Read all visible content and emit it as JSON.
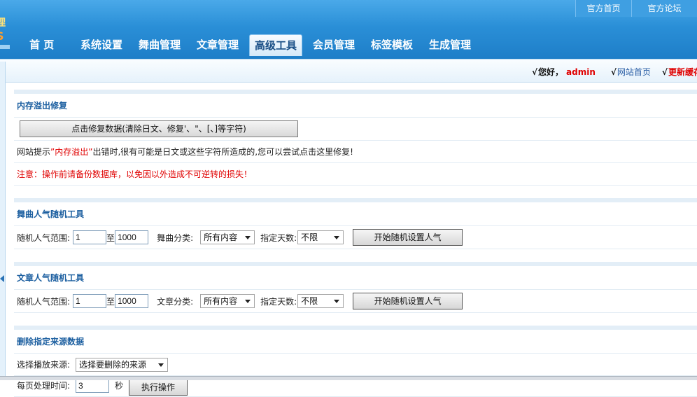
{
  "logo": {
    "char1": "理",
    "char2": "S"
  },
  "top_links": [
    "官方首页",
    "官方论坛"
  ],
  "nav": [
    {
      "label": "首  页",
      "active": false
    },
    {
      "label": "系统设置",
      "active": false
    },
    {
      "label": "舞曲管理",
      "active": false
    },
    {
      "label": "文章管理",
      "active": false
    },
    {
      "label": "高级工具",
      "active": true
    },
    {
      "label": "会员管理",
      "active": false
    },
    {
      "label": "标签模板",
      "active": false
    },
    {
      "label": "生成管理",
      "active": false
    }
  ],
  "userbar": {
    "check": "√",
    "greeting": "您好，",
    "username": "admin",
    "home_link": "网站首页",
    "refresh_link": "更新缓存"
  },
  "memory_fix": {
    "title": "内存溢出修复",
    "button": "点击修复数据(清除日文、修复'、\"、[、]等字符)",
    "tip_pre": "网站提示",
    "tip_hl": "”内存溢出”",
    "tip_post": "出错时,很有可能是日文或这些字符所造成的,您可以尝试点击这里修复!",
    "warning": "注意：操作前请备份数据库，以免因以外造成不可逆转的损失！"
  },
  "music_tool": {
    "title": "舞曲人气随机工具",
    "range_label": "随机人气范围:",
    "from": "1",
    "to_label": "至",
    "to": "1000",
    "category_label": "舞曲分类:",
    "category_value": "所有内容",
    "days_label": "指定天数:",
    "days_value": "不限",
    "button": "开始随机设置人气"
  },
  "article_tool": {
    "title": "文章人气随机工具",
    "range_label": "随机人气范围:",
    "from": "1",
    "to_label": "至",
    "to": "1000",
    "category_label": "文章分类:",
    "category_value": "所有内容",
    "days_label": "指定天数:",
    "days_value": "不限",
    "button": "开始随机设置人气"
  },
  "delete_source": {
    "title": "删除指定来源数据",
    "source_label": "选择播放来源:",
    "source_value": "选择要删除的来源",
    "time_label": "每页处理时间:",
    "time_value": "3",
    "time_unit": "秒",
    "button": "执行操作"
  }
}
